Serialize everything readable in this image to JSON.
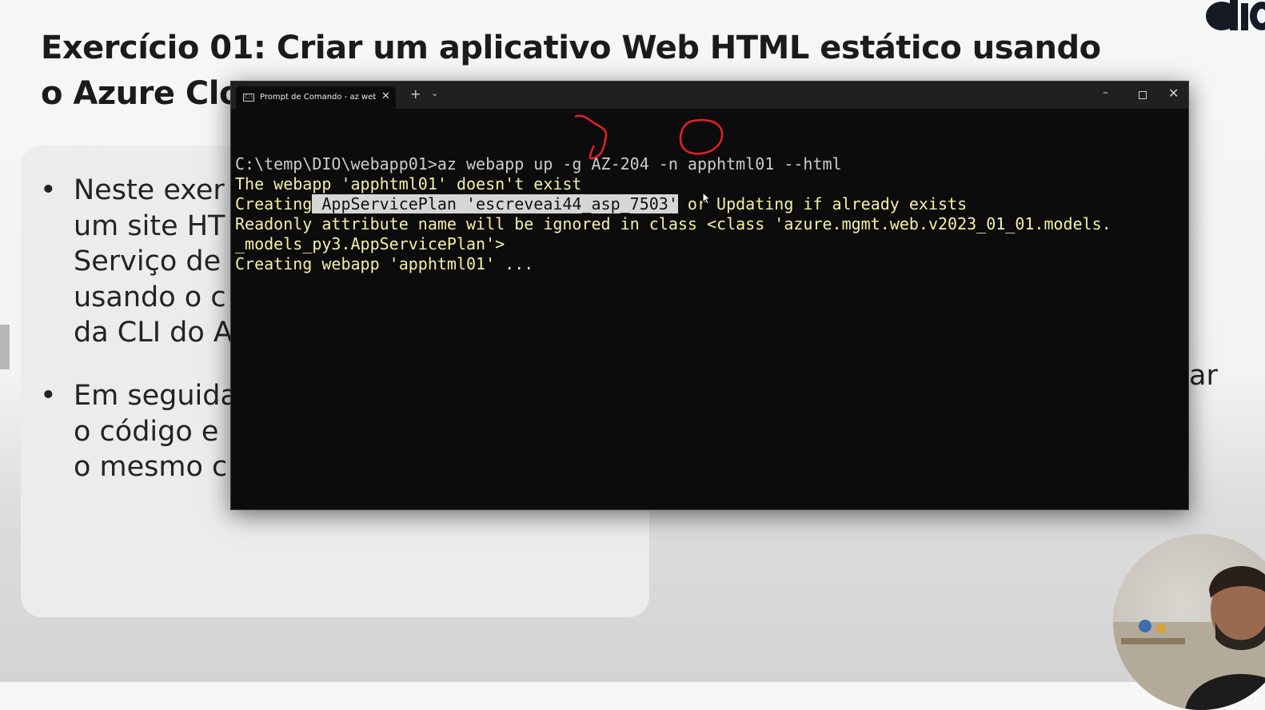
{
  "slide": {
    "title_line1": "Exercício 01: Criar um aplicativo Web HTML estático usando",
    "title_line2": "o Azure Clo",
    "bullet1_lines": "Neste exer\num site HT\nServiço de\nusando o c\nda CLI do A",
    "bullet2_lines": "Em seguida\no código e\no mesmo c",
    "right_fragment": "ar",
    "bullet_char": "•"
  },
  "terminal": {
    "tab_title": "Prompt de Comando - az  webapp up",
    "tab_close": "✕",
    "new_tab": "+",
    "tab_dropdown": "⌄",
    "minimize": "–",
    "close": "✕",
    "lines": {
      "l1": "C:\\temp\\DIO\\webapp01>az webapp up -g AZ-204 -n apphtml01 --html",
      "l2": "The webapp 'apphtml01' doesn't exist",
      "l3_a": "Creating",
      "l3_sel": " AppServicePlan 'escreveai44_asp_7503'",
      "l3_b": " or Updating if already exists",
      "l4": "Readonly attribute name will be ignored in class <class 'azure.mgmt.web.v2023_01_01.models.",
      "l5": "_models_py3.AppServicePlan'>",
      "l6": "Creating webapp 'apphtml01' ..."
    }
  },
  "colors": {
    "terminal_bg": "#0c0c0c",
    "output_text": "#f4f0a6",
    "command_text": "#cccccc",
    "annotation": "#e8202a"
  }
}
